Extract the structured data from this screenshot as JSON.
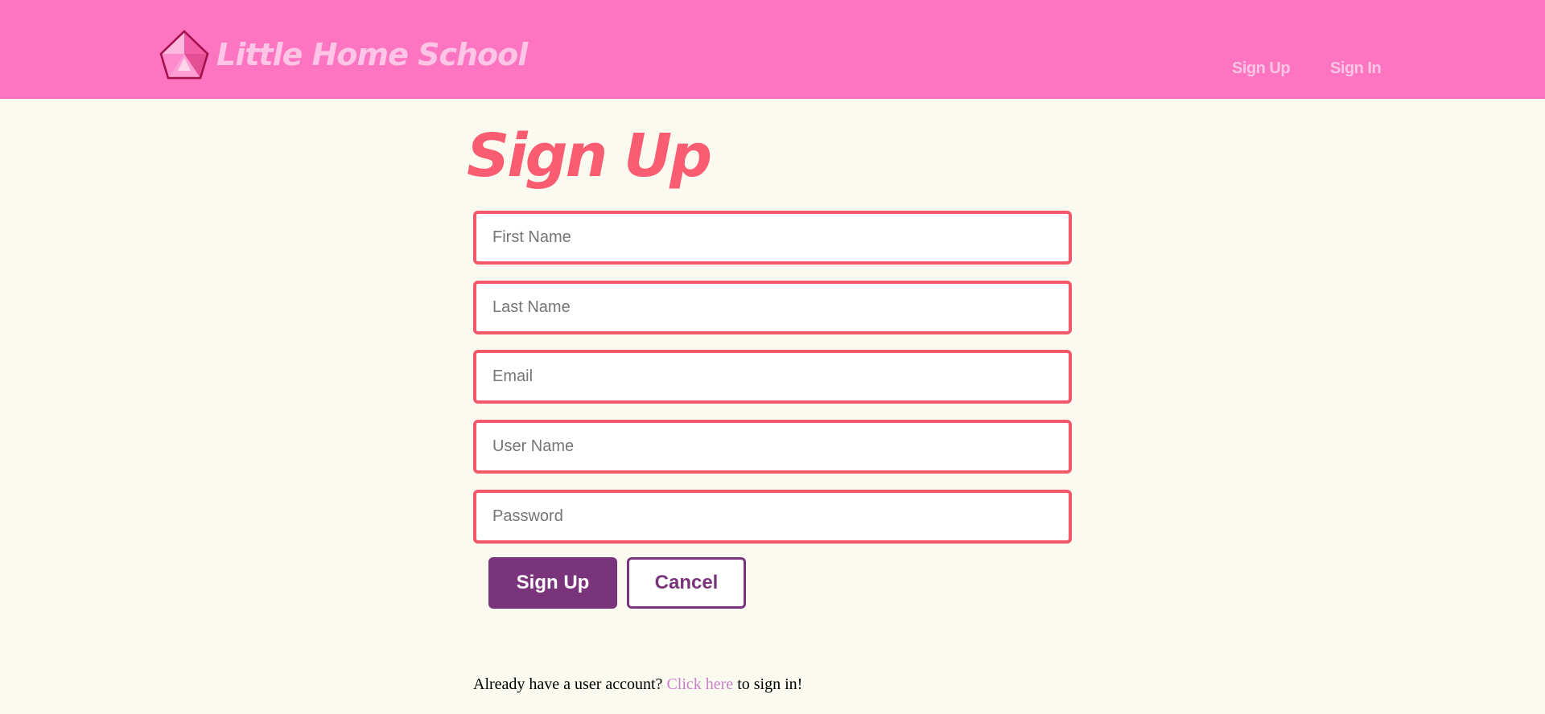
{
  "header": {
    "brand": "Little Home School",
    "nav": {
      "sign_up": "Sign Up",
      "sign_in": "Sign In"
    },
    "colors": {
      "background": "#fd75c1",
      "nav_text": "#ffc5e6",
      "gem_icon": "pink-gem-icon"
    }
  },
  "main": {
    "title": "Sign Up",
    "form": {
      "first_name": {
        "placeholder": "First Name",
        "value": ""
      },
      "last_name": {
        "placeholder": "Last Name",
        "value": ""
      },
      "email": {
        "placeholder": "Email",
        "value": ""
      },
      "user_name": {
        "placeholder": "User Name",
        "value": ""
      },
      "password": {
        "placeholder": "Password",
        "value": ""
      }
    },
    "buttons": {
      "submit": "Sign Up",
      "cancel": "Cancel"
    },
    "signin_prompt": {
      "before": "Already have a user account?",
      "link": "Click here",
      "after": "to sign in!"
    }
  },
  "colors": {
    "page_background": "#fbfaf0",
    "title": "#fa5c72",
    "input_border": "#f25869",
    "button_primary": "#7a347c",
    "link": "#c882c8"
  }
}
